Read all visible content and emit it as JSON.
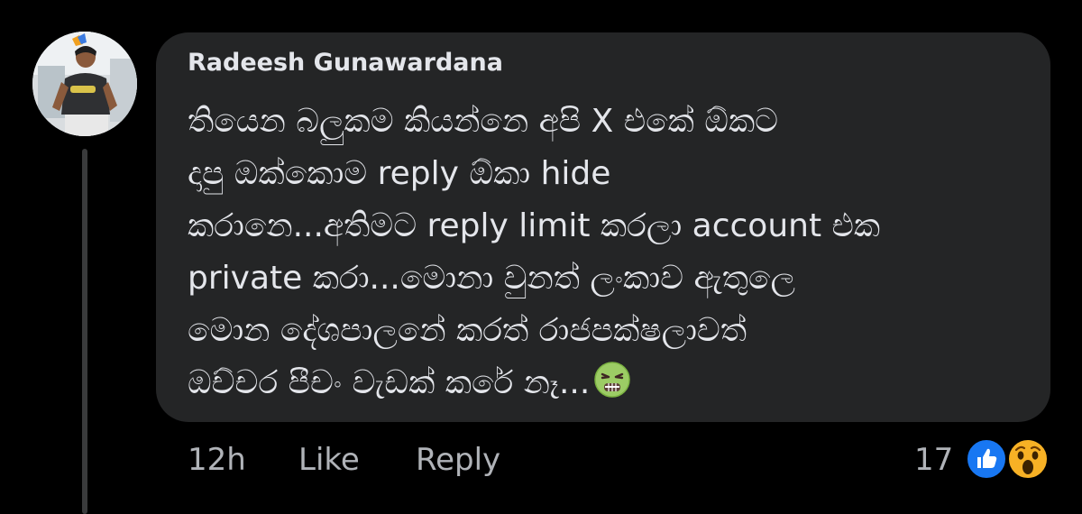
{
  "comment": {
    "author": "Radeesh Gunawardana",
    "lines": [
      "තියෙන බලුකම කියන්නෙ අපි X එකේ ඕකට",
      "දාපු ඔක්කොම reply ඕකා hide",
      "කරානෙ...අතිමට reply limit කරලා account එක",
      "private කරා...මොනා වුනත් ලංකාව ඇතුලෙ",
      "මොන දේශපාලනේ කරත් රාජපක්ෂලාවත්",
      "ඔච්චර පීචං වැඩක් කරේ නෑ..."
    ],
    "trailing_emoji": "nauseated-face-icon"
  },
  "footer": {
    "time": "12h",
    "like_label": "Like",
    "reply_label": "Reply",
    "reaction_count": "17",
    "reactions": [
      "like-reaction-icon",
      "wow-reaction-icon"
    ]
  },
  "colors": {
    "background": "#000000",
    "bubble": "#242526",
    "primary_text": "#e4e6eb",
    "secondary_text": "#b0b3b8",
    "like_blue": "#1877f2",
    "wow_yellow": "#f7b125"
  }
}
